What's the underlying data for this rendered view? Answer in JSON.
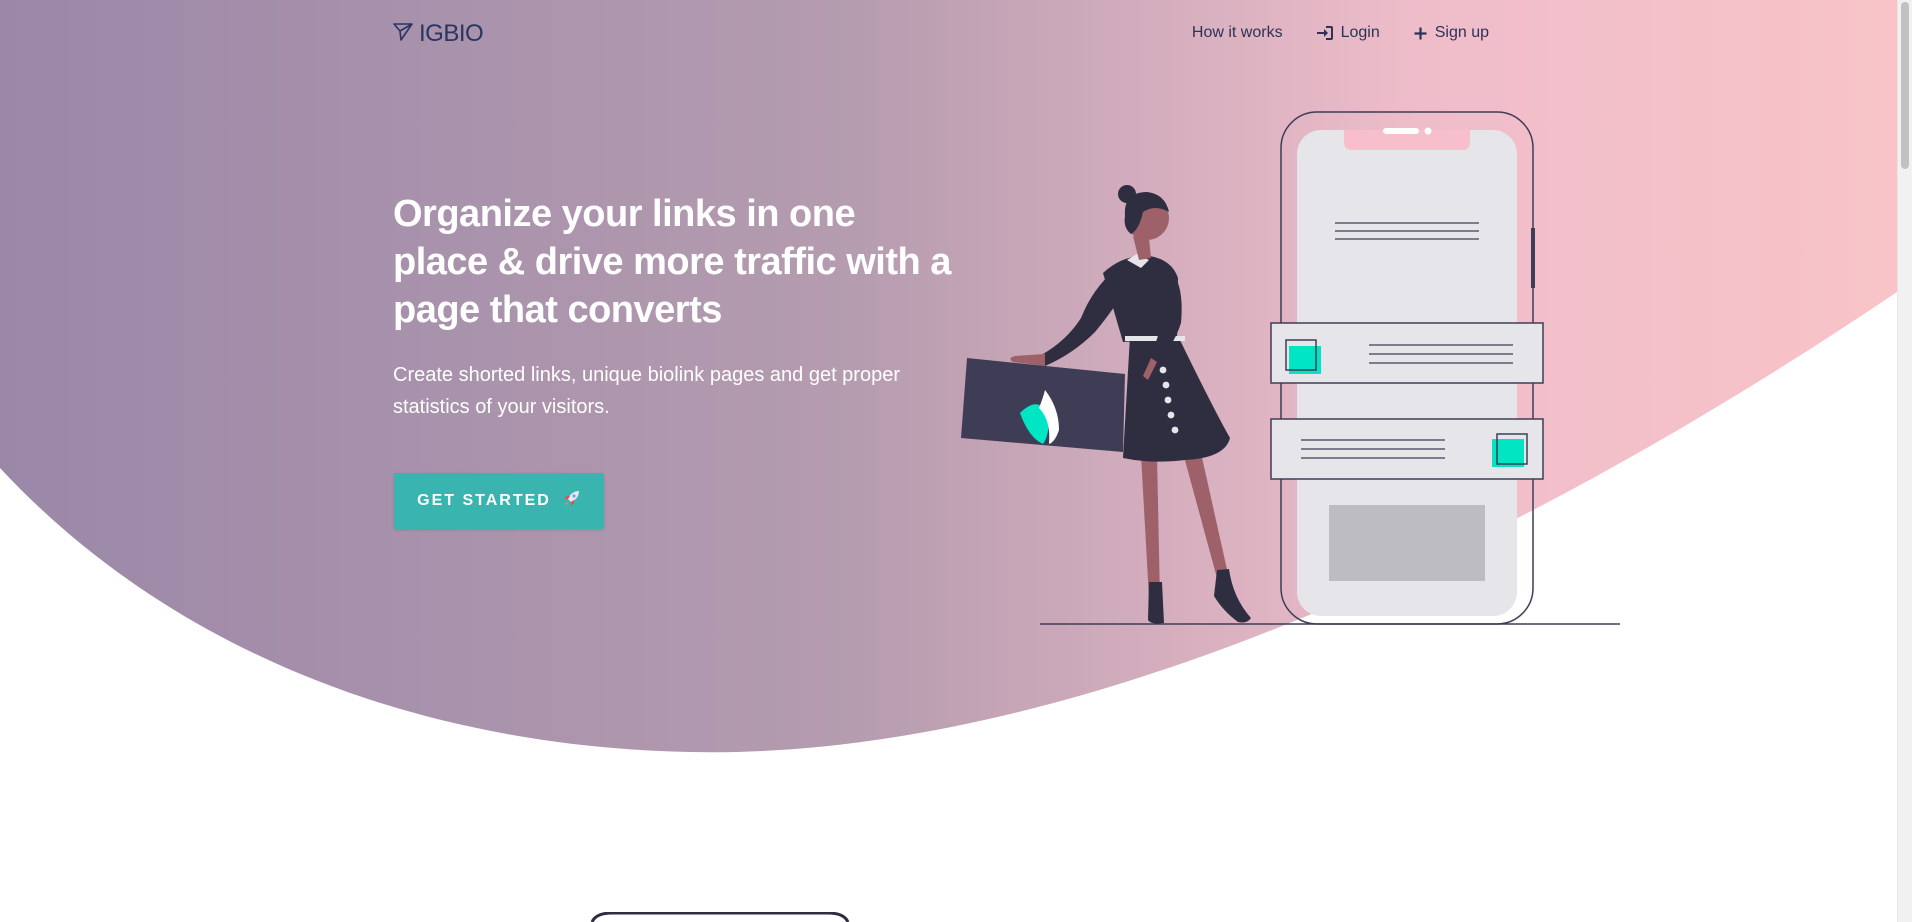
{
  "colors": {
    "gradient_start": "#9b87a8",
    "gradient_end": "#f8c2c9",
    "accent": "#3ab4ae",
    "nav_text": "#2c3356",
    "illustration_teal": "#00e5c4",
    "illustration_dark": "#2f2e41"
  },
  "brand": {
    "name": "IGBIO",
    "icon": "paper-plane-icon"
  },
  "nav": {
    "items": [
      {
        "label": "How it works",
        "icon": null
      },
      {
        "label": "Login",
        "icon": "sign-in-icon"
      },
      {
        "label": "Sign up",
        "icon": "plus-icon"
      }
    ]
  },
  "hero": {
    "title": "Organize your links in one place & drive more traffic with a page that converts",
    "subtitle": "Create shorted links, unique biolink pages and get proper statistics of your visitors.",
    "cta_label": "GET STARTED",
    "cta_icon": "rocket-icon"
  }
}
